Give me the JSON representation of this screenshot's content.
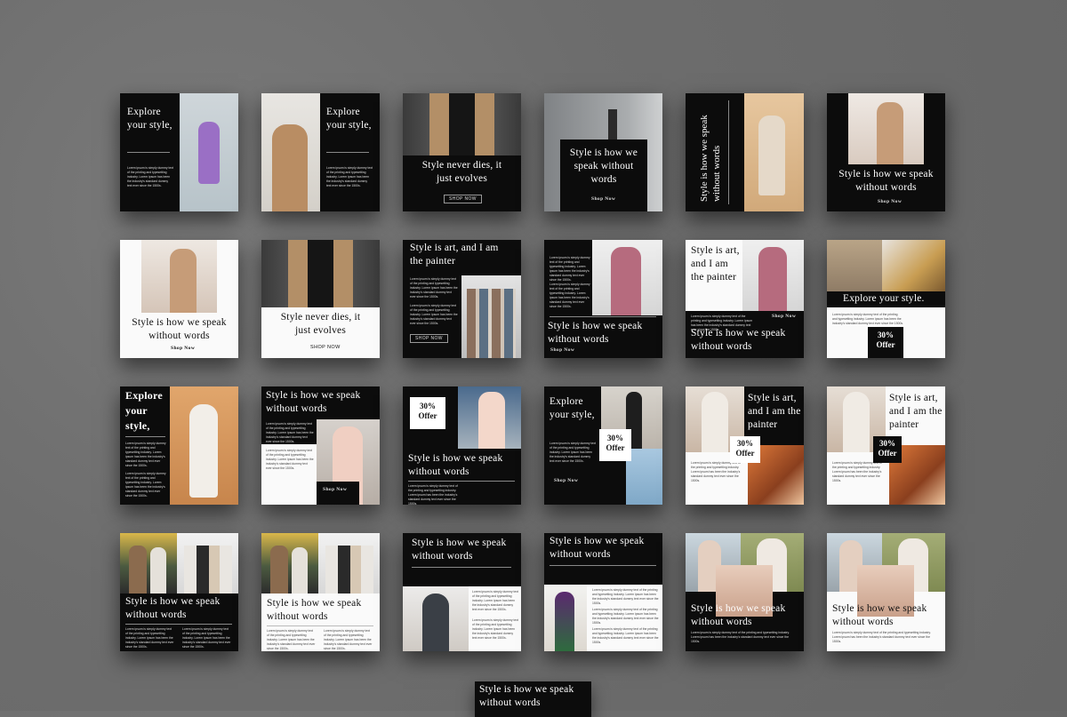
{
  "texts": {
    "explore": "Explore your style,",
    "explore_big": "Explore your style,",
    "explore_line": "Explore your style.",
    "never_dies": "Style never dies, it just evolves",
    "speak": "Style is how we speak without words",
    "art": "Style is art, and I am the painter",
    "offer_num": "30%",
    "offer_word": "Offer",
    "shop_caps": "SHOP NOW",
    "shop_title": "Shop Now",
    "lorem": "Lorem ipsum is simply dummy text of the printing and typesetting industry. Lorem ipsum has been the industry's standard dummy text ever since the 1500s."
  },
  "colors": {
    "wall": "#6f6f6f",
    "tile_dark": "#0c0c0c",
    "tile_light": "#fafafa",
    "photo_blue": "#b9c8cf",
    "photo_beige": "#d9b08a",
    "photo_gray": "#8a8d90",
    "photo_pink": "#c98a95",
    "photo_olive": "#9aa36d",
    "photo_tan": "#c9a77e"
  }
}
